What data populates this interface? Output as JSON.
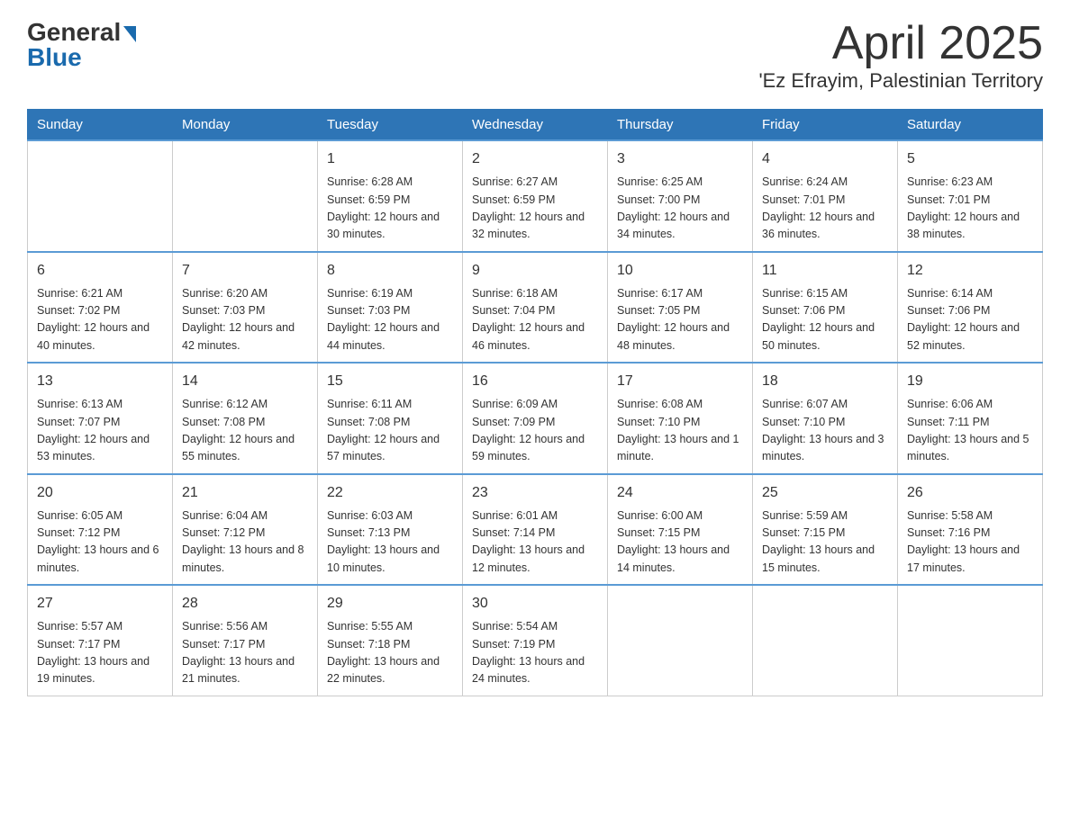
{
  "header": {
    "logo_general": "General",
    "logo_blue": "Blue",
    "title": "April 2025",
    "subtitle": "'Ez Efrayim, Palestinian Territory"
  },
  "days_of_week": [
    "Sunday",
    "Monday",
    "Tuesday",
    "Wednesday",
    "Thursday",
    "Friday",
    "Saturday"
  ],
  "weeks": [
    [
      {
        "day": "",
        "sunrise": "",
        "sunset": "",
        "daylight": ""
      },
      {
        "day": "",
        "sunrise": "",
        "sunset": "",
        "daylight": ""
      },
      {
        "day": "1",
        "sunrise": "Sunrise: 6:28 AM",
        "sunset": "Sunset: 6:59 PM",
        "daylight": "Daylight: 12 hours and 30 minutes."
      },
      {
        "day": "2",
        "sunrise": "Sunrise: 6:27 AM",
        "sunset": "Sunset: 6:59 PM",
        "daylight": "Daylight: 12 hours and 32 minutes."
      },
      {
        "day": "3",
        "sunrise": "Sunrise: 6:25 AM",
        "sunset": "Sunset: 7:00 PM",
        "daylight": "Daylight: 12 hours and 34 minutes."
      },
      {
        "day": "4",
        "sunrise": "Sunrise: 6:24 AM",
        "sunset": "Sunset: 7:01 PM",
        "daylight": "Daylight: 12 hours and 36 minutes."
      },
      {
        "day": "5",
        "sunrise": "Sunrise: 6:23 AM",
        "sunset": "Sunset: 7:01 PM",
        "daylight": "Daylight: 12 hours and 38 minutes."
      }
    ],
    [
      {
        "day": "6",
        "sunrise": "Sunrise: 6:21 AM",
        "sunset": "Sunset: 7:02 PM",
        "daylight": "Daylight: 12 hours and 40 minutes."
      },
      {
        "day": "7",
        "sunrise": "Sunrise: 6:20 AM",
        "sunset": "Sunset: 7:03 PM",
        "daylight": "Daylight: 12 hours and 42 minutes."
      },
      {
        "day": "8",
        "sunrise": "Sunrise: 6:19 AM",
        "sunset": "Sunset: 7:03 PM",
        "daylight": "Daylight: 12 hours and 44 minutes."
      },
      {
        "day": "9",
        "sunrise": "Sunrise: 6:18 AM",
        "sunset": "Sunset: 7:04 PM",
        "daylight": "Daylight: 12 hours and 46 minutes."
      },
      {
        "day": "10",
        "sunrise": "Sunrise: 6:17 AM",
        "sunset": "Sunset: 7:05 PM",
        "daylight": "Daylight: 12 hours and 48 minutes."
      },
      {
        "day": "11",
        "sunrise": "Sunrise: 6:15 AM",
        "sunset": "Sunset: 7:06 PM",
        "daylight": "Daylight: 12 hours and 50 minutes."
      },
      {
        "day": "12",
        "sunrise": "Sunrise: 6:14 AM",
        "sunset": "Sunset: 7:06 PM",
        "daylight": "Daylight: 12 hours and 52 minutes."
      }
    ],
    [
      {
        "day": "13",
        "sunrise": "Sunrise: 6:13 AM",
        "sunset": "Sunset: 7:07 PM",
        "daylight": "Daylight: 12 hours and 53 minutes."
      },
      {
        "day": "14",
        "sunrise": "Sunrise: 6:12 AM",
        "sunset": "Sunset: 7:08 PM",
        "daylight": "Daylight: 12 hours and 55 minutes."
      },
      {
        "day": "15",
        "sunrise": "Sunrise: 6:11 AM",
        "sunset": "Sunset: 7:08 PM",
        "daylight": "Daylight: 12 hours and 57 minutes."
      },
      {
        "day": "16",
        "sunrise": "Sunrise: 6:09 AM",
        "sunset": "Sunset: 7:09 PM",
        "daylight": "Daylight: 12 hours and 59 minutes."
      },
      {
        "day": "17",
        "sunrise": "Sunrise: 6:08 AM",
        "sunset": "Sunset: 7:10 PM",
        "daylight": "Daylight: 13 hours and 1 minute."
      },
      {
        "day": "18",
        "sunrise": "Sunrise: 6:07 AM",
        "sunset": "Sunset: 7:10 PM",
        "daylight": "Daylight: 13 hours and 3 minutes."
      },
      {
        "day": "19",
        "sunrise": "Sunrise: 6:06 AM",
        "sunset": "Sunset: 7:11 PM",
        "daylight": "Daylight: 13 hours and 5 minutes."
      }
    ],
    [
      {
        "day": "20",
        "sunrise": "Sunrise: 6:05 AM",
        "sunset": "Sunset: 7:12 PM",
        "daylight": "Daylight: 13 hours and 6 minutes."
      },
      {
        "day": "21",
        "sunrise": "Sunrise: 6:04 AM",
        "sunset": "Sunset: 7:12 PM",
        "daylight": "Daylight: 13 hours and 8 minutes."
      },
      {
        "day": "22",
        "sunrise": "Sunrise: 6:03 AM",
        "sunset": "Sunset: 7:13 PM",
        "daylight": "Daylight: 13 hours and 10 minutes."
      },
      {
        "day": "23",
        "sunrise": "Sunrise: 6:01 AM",
        "sunset": "Sunset: 7:14 PM",
        "daylight": "Daylight: 13 hours and 12 minutes."
      },
      {
        "day": "24",
        "sunrise": "Sunrise: 6:00 AM",
        "sunset": "Sunset: 7:15 PM",
        "daylight": "Daylight: 13 hours and 14 minutes."
      },
      {
        "day": "25",
        "sunrise": "Sunrise: 5:59 AM",
        "sunset": "Sunset: 7:15 PM",
        "daylight": "Daylight: 13 hours and 15 minutes."
      },
      {
        "day": "26",
        "sunrise": "Sunrise: 5:58 AM",
        "sunset": "Sunset: 7:16 PM",
        "daylight": "Daylight: 13 hours and 17 minutes."
      }
    ],
    [
      {
        "day": "27",
        "sunrise": "Sunrise: 5:57 AM",
        "sunset": "Sunset: 7:17 PM",
        "daylight": "Daylight: 13 hours and 19 minutes."
      },
      {
        "day": "28",
        "sunrise": "Sunrise: 5:56 AM",
        "sunset": "Sunset: 7:17 PM",
        "daylight": "Daylight: 13 hours and 21 minutes."
      },
      {
        "day": "29",
        "sunrise": "Sunrise: 5:55 AM",
        "sunset": "Sunset: 7:18 PM",
        "daylight": "Daylight: 13 hours and 22 minutes."
      },
      {
        "day": "30",
        "sunrise": "Sunrise: 5:54 AM",
        "sunset": "Sunset: 7:19 PM",
        "daylight": "Daylight: 13 hours and 24 minutes."
      },
      {
        "day": "",
        "sunrise": "",
        "sunset": "",
        "daylight": ""
      },
      {
        "day": "",
        "sunrise": "",
        "sunset": "",
        "daylight": ""
      },
      {
        "day": "",
        "sunrise": "",
        "sunset": "",
        "daylight": ""
      }
    ]
  ]
}
